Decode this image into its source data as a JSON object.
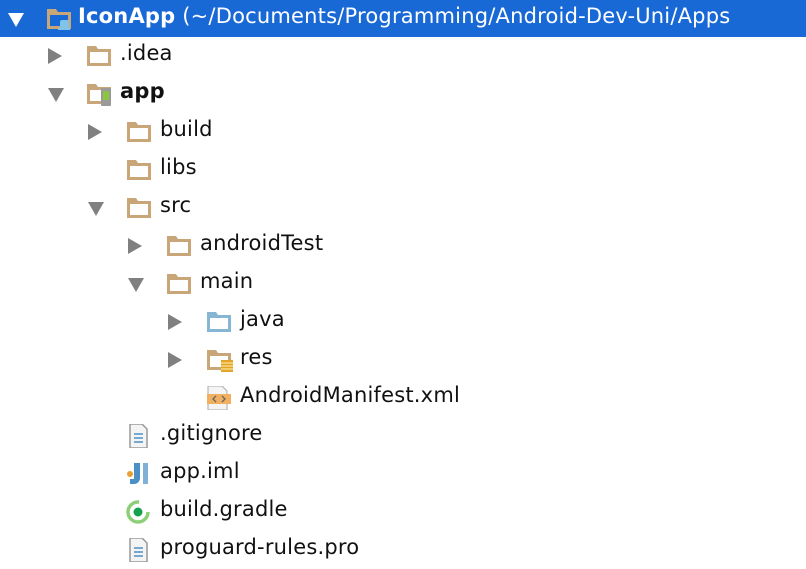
{
  "tree": [
    {
      "label": "IconApp (~/Documents/Programming/Android-Dev-Uni/Apps",
      "level": 0,
      "toggle": "expanded",
      "icon": "project-folder-icon",
      "bold_prefix": "IconApp",
      "selected": true
    },
    {
      "label": ".idea",
      "level": 1,
      "toggle": "collapsed",
      "icon": "folder-icon"
    },
    {
      "label": "app",
      "level": 1,
      "toggle": "expanded",
      "icon": "android-module-folder-icon",
      "bold": true
    },
    {
      "label": "build",
      "level": 2,
      "toggle": "collapsed",
      "icon": "folder-icon"
    },
    {
      "label": "libs",
      "level": 2,
      "toggle": "none",
      "icon": "folder-icon"
    },
    {
      "label": "src",
      "level": 2,
      "toggle": "expanded",
      "icon": "folder-icon"
    },
    {
      "label": "androidTest",
      "level": 3,
      "toggle": "collapsed",
      "icon": "folder-icon"
    },
    {
      "label": "main",
      "level": 3,
      "toggle": "expanded",
      "icon": "folder-icon"
    },
    {
      "label": "java",
      "level": 4,
      "toggle": "collapsed",
      "icon": "source-folder-icon"
    },
    {
      "label": "res",
      "level": 4,
      "toggle": "collapsed",
      "icon": "resource-folder-icon"
    },
    {
      "label": "AndroidManifest.xml",
      "level": 4,
      "toggle": "none",
      "icon": "xml-file-icon"
    },
    {
      "label": ".gitignore",
      "level": 2,
      "toggle": "none",
      "icon": "text-file-icon"
    },
    {
      "label": "app.iml",
      "level": 2,
      "toggle": "none",
      "icon": "iml-file-icon"
    },
    {
      "label": "build.gradle",
      "level": 2,
      "toggle": "none",
      "icon": "gradle-file-icon"
    },
    {
      "label": "proguard-rules.pro",
      "level": 2,
      "toggle": "none",
      "icon": "text-file-icon"
    }
  ],
  "colors": {
    "selection": "#1869d6",
    "folder": "#c9a678",
    "source_folder": "#86b6d2",
    "arrow": "#808080"
  }
}
